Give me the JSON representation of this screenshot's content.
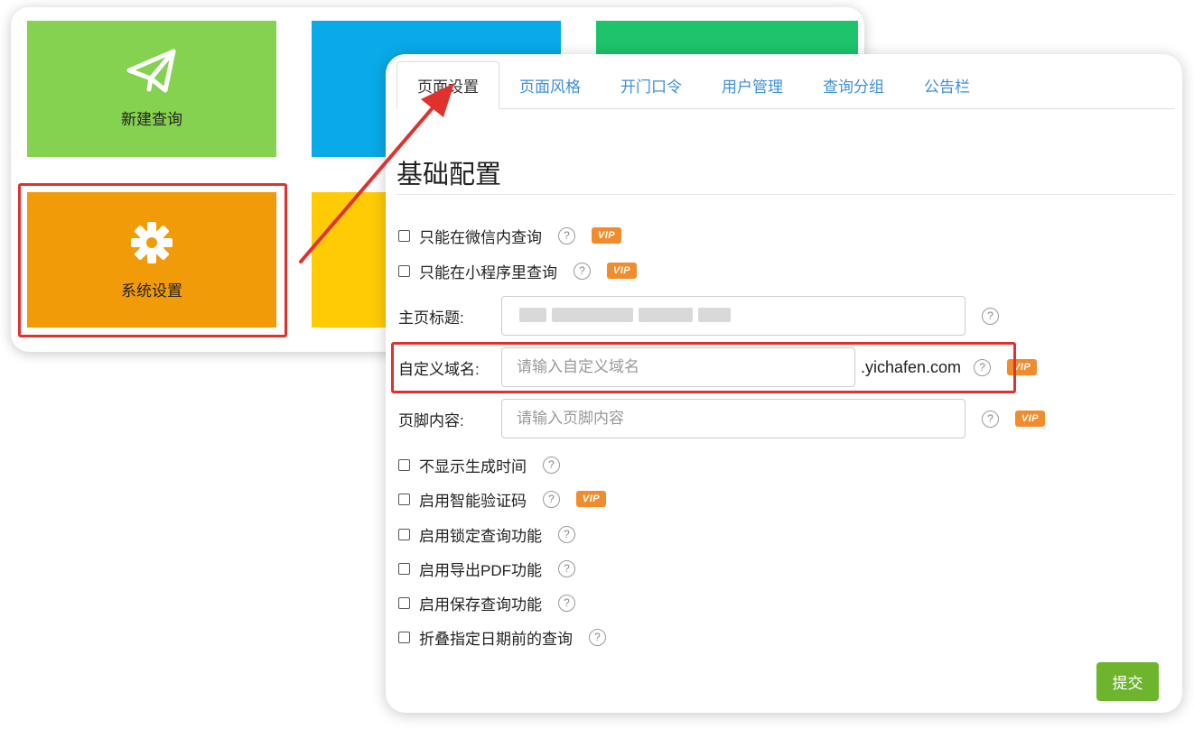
{
  "tiles": {
    "new_query_label": "新建查询",
    "settings_label": "系统设置",
    "colors": {
      "new_query": "#85d150",
      "blue": "#08aae8",
      "green": "#1dc46b",
      "settings": "#f09b07",
      "yellow": "#ffcb05"
    }
  },
  "tabs": [
    {
      "label": "页面设置",
      "active": true
    },
    {
      "label": "页面风格",
      "active": false
    },
    {
      "label": "开门口令",
      "active": false
    },
    {
      "label": "用户管理",
      "active": false
    },
    {
      "label": "查询分组",
      "active": false
    },
    {
      "label": "公告栏",
      "active": false
    }
  ],
  "section_title": "基础配置",
  "options_top": [
    {
      "label": "只能在微信内查询",
      "vip": true
    },
    {
      "label": "只能在小程序里查询",
      "vip": true
    }
  ],
  "fields": {
    "homepage_title": {
      "label": "主页标题:"
    },
    "custom_domain": {
      "label": "自定义域名:",
      "placeholder": "请输入自定义域名",
      "suffix": ".yichafen.com",
      "vip": true
    },
    "footer": {
      "label": "页脚内容:",
      "placeholder": "请输入页脚内容",
      "vip": true
    }
  },
  "options_bottom": [
    {
      "label": "不显示生成时间",
      "vip": false
    },
    {
      "label": "启用智能验证码",
      "vip": true
    },
    {
      "label": "启用锁定查询功能",
      "vip": false
    },
    {
      "label": "启用导出PDF功能",
      "vip": false
    },
    {
      "label": "启用保存查询功能",
      "vip": false
    },
    {
      "label": "折叠指定日期前的查询",
      "vip": false
    }
  ],
  "help_glyph": "?",
  "vip_badge": "VIP",
  "submit_label": "提交",
  "accent_colors": {
    "tab_link": "#3f8fd8",
    "vip": "#f08c2b",
    "submit": "#6cb52d",
    "highlight": "#e0312d"
  }
}
